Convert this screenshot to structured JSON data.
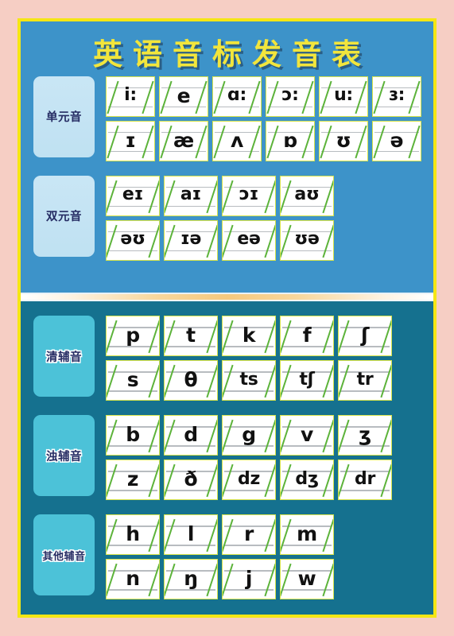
{
  "poster": {
    "title": "英语音标发音表",
    "colors": {
      "outer_background": "#f6cec4",
      "frame_border": "#f5e614",
      "vowel_panel": "#3d93c9",
      "consonant_panel": "#15718f",
      "title_text": "#f2e53c",
      "vowel_label_box": "#c9e6f5",
      "consonant_label_box": "#4cc2d8",
      "label_text": "#252c63",
      "card_background": "#ffffff",
      "card_border": "#d7e34a",
      "card_guide_line": "#b8bcc0",
      "slash": "#5cb33a",
      "symbol_text": "#111111",
      "divider_band": "#f6c97e"
    }
  },
  "sections": [
    {
      "id": "monophthongs",
      "label": "单元音",
      "card_width": "narrow",
      "rows": [
        [
          "i:",
          "e",
          "ɑ:",
          "ɔ:",
          "u:",
          "ɜ:"
        ],
        [
          "ɪ",
          "æ",
          "ʌ",
          "ɒ",
          "ʊ",
          "ə"
        ]
      ]
    },
    {
      "id": "diphthongs",
      "label": "双元音",
      "card_width": "wide",
      "rows": [
        [
          "eɪ",
          "aɪ",
          "ɔɪ",
          "aʊ"
        ],
        [
          "əʊ",
          "ɪə",
          "eə",
          "ʊə"
        ]
      ]
    },
    {
      "id": "voiceless-consonants",
      "label": "清辅音",
      "card_width": "wide",
      "rows": [
        [
          "p",
          "t",
          "k",
          "f",
          "ʃ"
        ],
        [
          "s",
          "θ",
          "ts",
          "tʃ",
          "tr"
        ]
      ]
    },
    {
      "id": "voiced-consonants",
      "label": "浊辅音",
      "card_width": "wide",
      "rows": [
        [
          "b",
          "d",
          "g",
          "v",
          "ʒ"
        ],
        [
          "z",
          "ð",
          "dz",
          "dʒ",
          "dr"
        ]
      ]
    },
    {
      "id": "other-consonants",
      "label": "其他辅音",
      "card_width": "wide",
      "rows": [
        [
          "h",
          "l",
          "r",
          "m"
        ],
        [
          "n",
          "ŋ",
          "j",
          "w"
        ]
      ]
    }
  ]
}
